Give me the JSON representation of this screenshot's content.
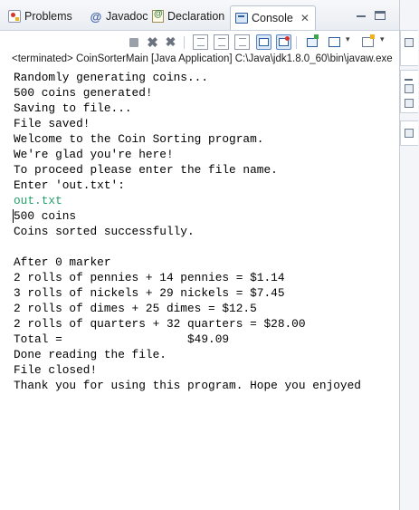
{
  "tabs": [
    {
      "label": "Problems",
      "icon": "problems-icon",
      "active": false
    },
    {
      "label": "Javadoc",
      "icon": "at-icon",
      "active": false
    },
    {
      "label": "Declaration",
      "icon": "declaration-icon",
      "active": false
    },
    {
      "label": "Console",
      "icon": "console-icon",
      "active": true,
      "close_glyph": "✕"
    }
  ],
  "toolbar": {
    "x_glyph": "✖",
    "xx_glyph": "✖",
    "chevron_glyph": "▾"
  },
  "status_line": "<terminated> CoinSorterMain [Java Application] C:\\Java\\jdk1.8.0_60\\bin\\javaw.exe",
  "console": {
    "lines": [
      {
        "text": "Randomly generating coins...",
        "kind": "output"
      },
      {
        "text": "500 coins generated!",
        "kind": "output"
      },
      {
        "text": "Saving to file...",
        "kind": "output"
      },
      {
        "text": "File saved!",
        "kind": "output"
      },
      {
        "text": "Welcome to the Coin Sorting program.",
        "kind": "output"
      },
      {
        "text": "We're glad you're here!",
        "kind": "output"
      },
      {
        "text": "To proceed please enter the file name.",
        "kind": "output"
      },
      {
        "text": "Enter 'out.txt':",
        "kind": "output"
      },
      {
        "text": "out.txt",
        "kind": "input"
      },
      {
        "text": "500 coins",
        "kind": "output"
      },
      {
        "text": "Coins sorted successfully.",
        "kind": "output"
      },
      {
        "text": "",
        "kind": "output"
      },
      {
        "text": "After 0 marker",
        "kind": "output"
      },
      {
        "text": "2 rolls of pennies + 14 pennies = $1.14",
        "kind": "output"
      },
      {
        "text": "3 rolls of nickels + 29 nickels = $7.45",
        "kind": "output"
      },
      {
        "text": "2 rolls of dimes + 25 dimes = $12.5",
        "kind": "output"
      },
      {
        "text": "2 rolls of quarters + 32 quarters = $28.00",
        "kind": "output"
      },
      {
        "text": "Total =                  $49.09",
        "kind": "output"
      },
      {
        "text": "Done reading the file.",
        "kind": "output"
      },
      {
        "text": "File closed!",
        "kind": "output"
      },
      {
        "text": "Thank you for using this program. Hope you enjoyed",
        "kind": "output"
      }
    ]
  },
  "colors": {
    "input_text": "#21a06a",
    "tab_bar": "#e9edf2",
    "border": "#c9d1dc"
  }
}
